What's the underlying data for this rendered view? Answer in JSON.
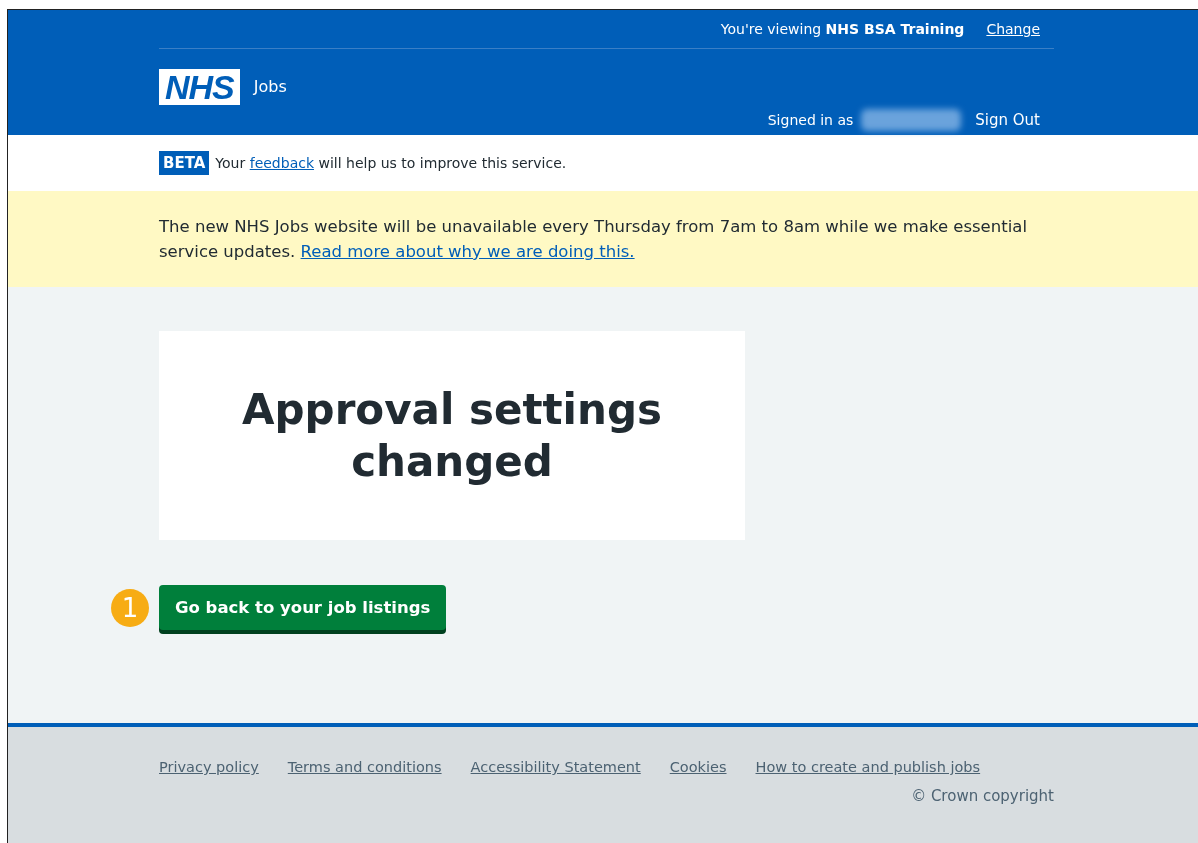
{
  "header": {
    "viewing_prefix": "You're viewing",
    "organisation": "NHS BSA Training",
    "change_link": "Change",
    "logo": "NHS",
    "service_name": "Jobs",
    "signed_in_label": "Signed in as",
    "sign_out": "Sign Out"
  },
  "phase_banner": {
    "tag": "BETA",
    "text_before": "Your",
    "link": "feedback",
    "text_after": "will help us to improve this service."
  },
  "notice": {
    "text": "The new NHS Jobs website will be unavailable every Thursday from 7am to 8am while we make essential service updates.",
    "link": "Read more about why we are doing this."
  },
  "panel": {
    "title": "Approval settings changed"
  },
  "callout": {
    "number": "1"
  },
  "primary_button": "Go back to your job listings",
  "footer": {
    "links": [
      "Privacy policy",
      "Terms and conditions",
      "Accessibility Statement",
      "Cookies",
      "How to create and publish jobs"
    ],
    "copyright": "© Crown copyright"
  }
}
